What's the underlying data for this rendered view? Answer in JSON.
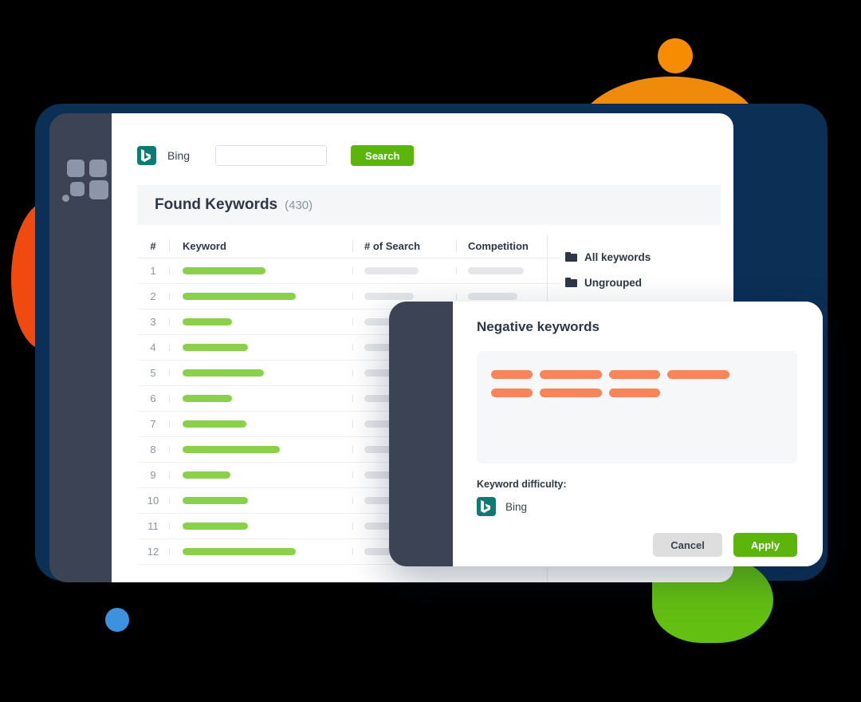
{
  "app": {
    "sidebar_logo_icon": "grid-squares-icon"
  },
  "search": {
    "engine_icon": "bing-logo-icon",
    "engine_label": "Bing",
    "input_value": "",
    "input_placeholder": "",
    "button_label": "Search"
  },
  "banner": {
    "title": "Found Keywords",
    "count": "(430)"
  },
  "table": {
    "columns": [
      "#",
      "Keyword",
      "# of Search",
      "Competition"
    ],
    "rows": [
      {
        "num": "1",
        "keyword_bar": 104,
        "search_bar": 68,
        "competition_bar": 70
      },
      {
        "num": "2",
        "keyword_bar": 142,
        "search_bar": 62,
        "competition_bar": 62
      },
      {
        "num": "3",
        "keyword_bar": 62,
        "search_bar": 58,
        "competition_bar": 58
      },
      {
        "num": "4",
        "keyword_bar": 82,
        "search_bar": 62,
        "competition_bar": 60
      },
      {
        "num": "5",
        "keyword_bar": 102,
        "search_bar": 60,
        "competition_bar": 58
      },
      {
        "num": "6",
        "keyword_bar": 62,
        "search_bar": 64,
        "competition_bar": 62
      },
      {
        "num": "7",
        "keyword_bar": 80,
        "search_bar": 58,
        "competition_bar": 56
      },
      {
        "num": "8",
        "keyword_bar": 122,
        "search_bar": 62,
        "competition_bar": 60
      },
      {
        "num": "9",
        "keyword_bar": 60,
        "search_bar": 60,
        "competition_bar": 58
      },
      {
        "num": "10",
        "keyword_bar": 82,
        "search_bar": 62,
        "competition_bar": 60
      },
      {
        "num": "11",
        "keyword_bar": 82,
        "search_bar": 58,
        "competition_bar": 58
      },
      {
        "num": "12",
        "keyword_bar": 142,
        "search_bar": 62,
        "competition_bar": 60
      }
    ]
  },
  "folders": {
    "items": [
      {
        "icon": "folder-icon",
        "label": "All keywords",
        "type": "label"
      },
      {
        "icon": "folder-icon",
        "label": "Ungrouped",
        "type": "label"
      },
      {
        "icon": "folder-icon",
        "label": "",
        "type": "bar"
      }
    ]
  },
  "modal": {
    "title": "Negative keywords",
    "keyword_pills": [
      [
        52,
        78,
        64,
        78
      ],
      [
        52,
        78,
        64
      ]
    ],
    "difficulty_label": "Keyword difficulty:",
    "engine_icon": "bing-logo-icon",
    "engine_label": "Bing",
    "cancel_label": "Cancel",
    "apply_label": "Apply"
  },
  "colors": {
    "frame_navy": "#0C2F55",
    "sidebar_dark": "#3B4354",
    "accent_green": "#5CB50B",
    "bar_green": "#8BD04B",
    "bar_gray": "#E4E6E9",
    "pill_orange": "#F7845A",
    "blob_orange": "#F08A0B",
    "blob_red": "#F04A10",
    "blob_blue": "#3C92DF",
    "blob_green": "#63BF12",
    "bing_teal": "#0E7A74"
  },
  "decor": {
    "orange_dot": "orange-circle",
    "orange_top": "orange-blob",
    "red_left": "red-blob",
    "green_bottom": "green-blob",
    "blue_dot": "blue-circle"
  }
}
